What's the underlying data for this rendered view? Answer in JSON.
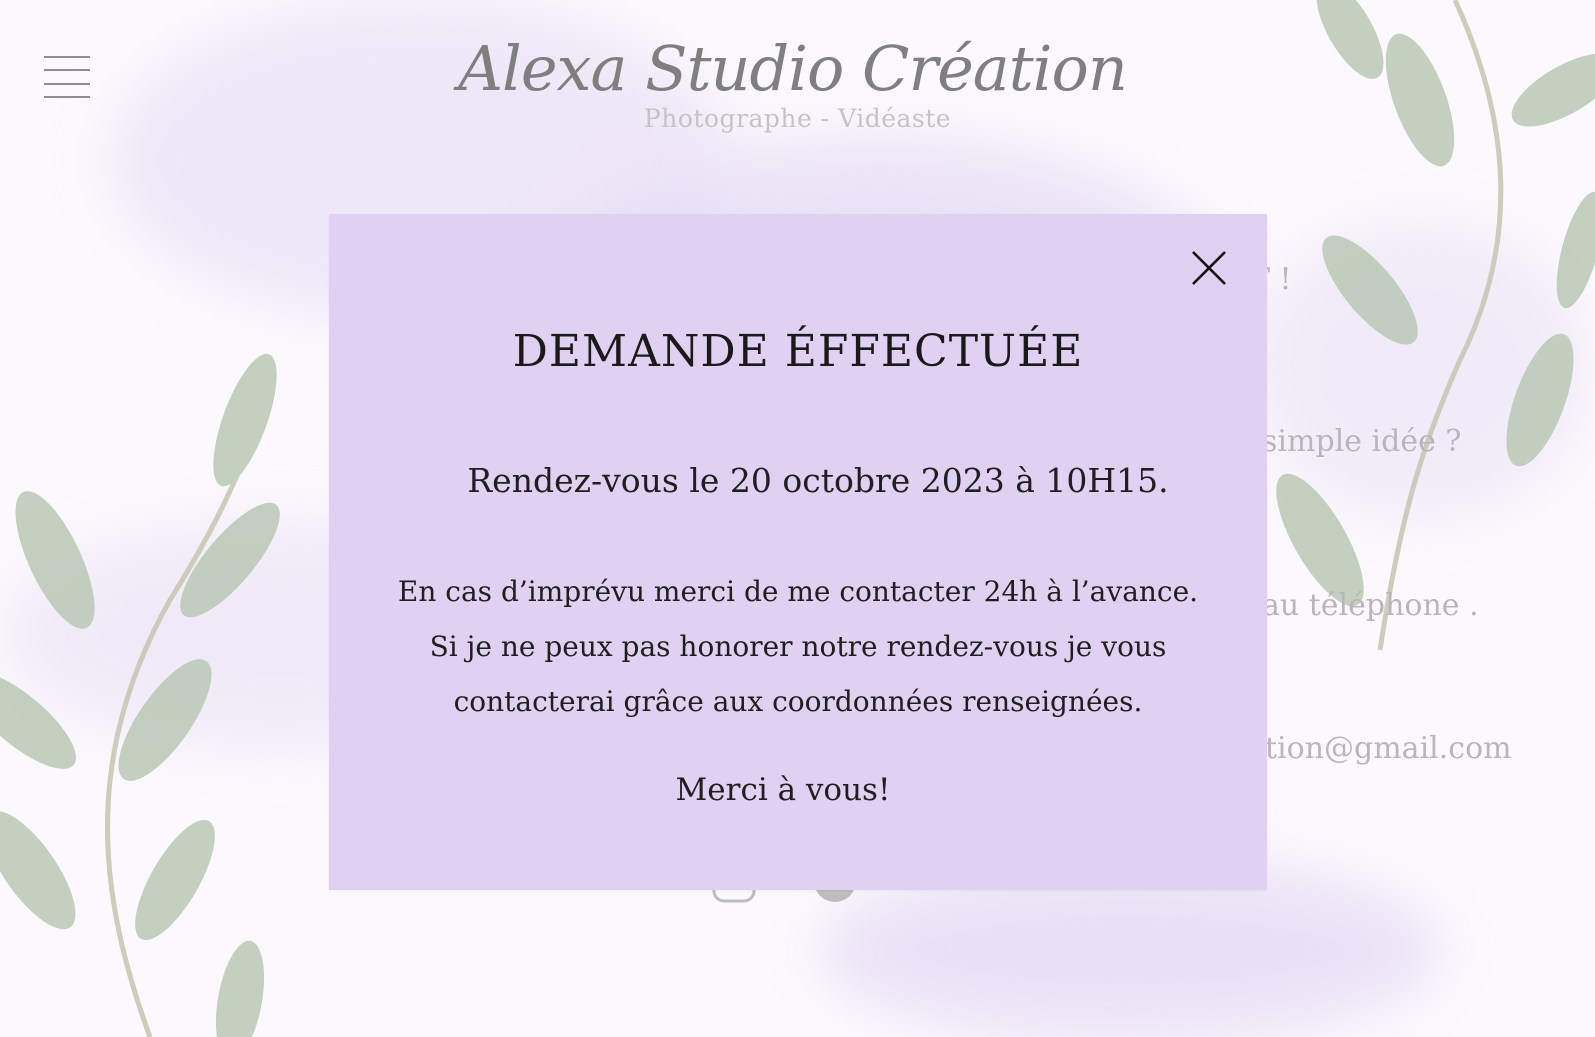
{
  "header": {
    "menu_icon": "hamburger-icon",
    "brand_title": "Alexa Studio Création",
    "brand_subtitle": "Photographe - Vidéaste"
  },
  "background_text": {
    "line1": "T !",
    "line2": "simple idée ?",
    "line3": "au téléphone .",
    "line4": "tion@gmail.com"
  },
  "social": {
    "instagram_icon": "instagram-icon",
    "facebook_icon": "facebook-icon"
  },
  "modal": {
    "close_icon": "close-icon",
    "title": "DEMANDE ÉFFECTUÉE",
    "date_line": "Rendez-vous le 20 octobre 2023 à 10H15.",
    "body_lines": [
      "En cas d’imprévu merci de me contacter 24h à l’avance.",
      "Si je ne peux pas honorer notre rendez-vous je vous",
      "contacterai grâce aux coordonnées renseignées."
    ],
    "thanks": "Merci à vous!"
  },
  "colors": {
    "modal_background": "#e0d1f3",
    "page_background": "#fbf9fd",
    "leaf_green": "#b7c5b2",
    "brand_grey": "#7f7f7f"
  }
}
